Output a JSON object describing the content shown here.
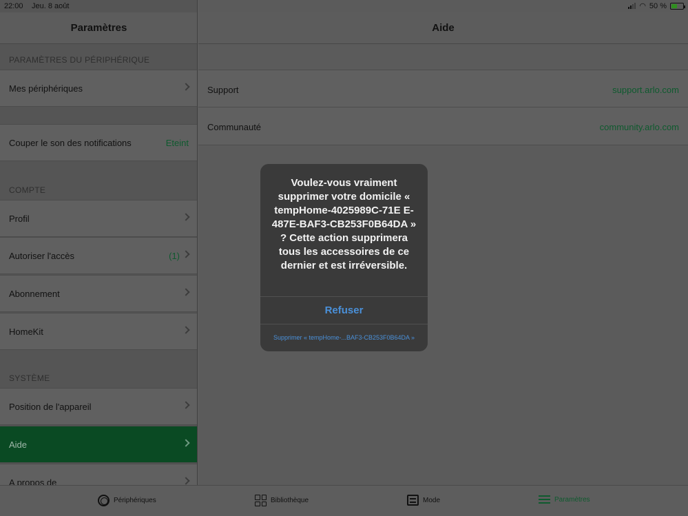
{
  "status_bar": {
    "time": "22:00",
    "date": "Jeu. 8 août",
    "battery": "50 %",
    "battery_level": 0.5
  },
  "left": {
    "title": "Paramètres",
    "sections": {
      "device": "PARAMÈTRES DU PÉRIPHÉRIQUE",
      "account": "COMPTE",
      "system": "SYSTÈME"
    },
    "items": {
      "my_devices": "Mes périphériques",
      "mute_notifications": "Couper le son des notifications",
      "mute_value": "Eteint",
      "profile": "Profil",
      "grant_access": "Autoriser l'accès",
      "grant_access_count": "(1)",
      "subscription": "Abonnement",
      "homekit": "HomeKit",
      "device_position": "Position de l'appareil",
      "help": "Aide",
      "about": "A propos de"
    }
  },
  "right": {
    "title": "Aide",
    "rows": [
      {
        "label": "Support",
        "link": "support.arlo.com"
      },
      {
        "label": "Communauté",
        "link": "community.arlo.com"
      }
    ]
  },
  "alert": {
    "message": "Voulez-vous vraiment supprimer votre domicile « tempHome-4025989C-71E E-487E-BAF3-CB253F0B64DA » ? Cette action supprimera tous les accessoires de ce dernier et est irréversible.",
    "refuse": "Refuser",
    "delete": "Supprimer « tempHome-...BAF3-CB253F0B64DA »"
  },
  "tabs": [
    {
      "label": "Périphériques",
      "icon": "devices-icon"
    },
    {
      "label": "Bibliothèque",
      "icon": "library-icon"
    },
    {
      "label": "Mode",
      "icon": "mode-icon"
    },
    {
      "label": "Paramètres",
      "icon": "menu-icon",
      "active": true
    }
  ],
  "colors": {
    "accent_green": "#0e5a2e",
    "selected_row": "#0a4a23",
    "alert_button": "#4a90d9"
  }
}
